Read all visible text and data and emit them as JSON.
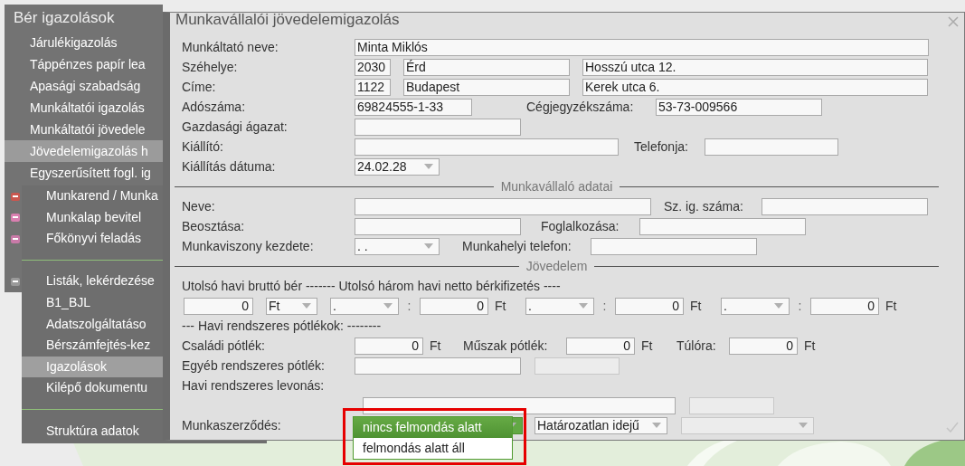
{
  "menu": {
    "title": "Bér igazolások",
    "items": [
      {
        "label": "Járulékigazolás",
        "selected": false
      },
      {
        "label": "Táppénzes papír lea",
        "selected": false
      },
      {
        "label": "Apasági szabadság",
        "selected": false
      },
      {
        "label": "Munkáltatói igazolás",
        "selected": false
      },
      {
        "label": "Munkáltatói jövedele",
        "selected": false
      },
      {
        "label": "Jövedelemigazolás h",
        "selected": true
      },
      {
        "label": "Egyszerűsített fogl. ig",
        "selected": false
      }
    ]
  },
  "submenu": {
    "items": [
      {
        "kind": "item",
        "label": "Munkarend / Munka",
        "selected": false,
        "icon": true
      },
      {
        "kind": "item",
        "label": "Munkalap bevitel",
        "selected": false,
        "icon": true
      },
      {
        "kind": "item",
        "label": "Főkönyvi feladás",
        "selected": false,
        "icon": true
      },
      {
        "kind": "divider"
      },
      {
        "kind": "item",
        "label": "Listák, lekérdezése",
        "selected": false,
        "icon": true
      },
      {
        "kind": "item",
        "label": "B1_BJL",
        "selected": false,
        "icon": false
      },
      {
        "kind": "item",
        "label": "Adatszolgáltatáso",
        "selected": false,
        "icon": false
      },
      {
        "kind": "item",
        "label": "Bérszámfejtés-kez",
        "selected": false,
        "icon": false
      },
      {
        "kind": "item",
        "label": "Igazolások",
        "selected": true,
        "icon": false
      },
      {
        "kind": "item",
        "label": "Kilépő dokumentu",
        "selected": false,
        "icon": false
      },
      {
        "kind": "divider"
      },
      {
        "kind": "item",
        "label": "Struktúra adatok",
        "selected": false,
        "icon": false
      }
    ]
  },
  "dialog": {
    "title": "Munkavállalói jövedelemigazolás",
    "employer": {
      "name": {
        "label": "Munkáltató neve:",
        "value": "Minta Miklós"
      },
      "seat": {
        "label": "Széhelye:",
        "zip": "2030",
        "city": "Érd",
        "street": "Hosszú utca 12."
      },
      "address": {
        "label": "Címe:",
        "zip": "1122",
        "city": "Budapest",
        "street": "Kerek utca 6."
      },
      "tax_number": {
        "label": "Adószáma:",
        "value": "69824555-1-33"
      },
      "registration_number": {
        "label": "Cégjegyzékszáma:",
        "value": "53-73-009566"
      },
      "sector": {
        "label": "Gazdasági ágazat:"
      },
      "issuer": {
        "label": "Kiállító:"
      },
      "phone": {
        "label": "Telefonja:"
      },
      "issue_date": {
        "label": "Kiállítás dátuma:",
        "value": "24.02.28"
      }
    },
    "employee_section": "Munkavállaló adatai",
    "employee": {
      "name": {
        "label": "Neve:"
      },
      "id_number": {
        "label": "Sz. ig. száma:"
      },
      "position": {
        "label": "Beosztása:"
      },
      "occupation": {
        "label": "Foglalkozása:"
      },
      "start_date": {
        "label": "Munkaviszony kezdete:",
        "value": ". ."
      },
      "work_phone": {
        "label": "Munkahelyi telefon:"
      }
    },
    "income_section": "Jövedelem",
    "income": {
      "heading": "Utolsó havi bruttó bér  ------- Utolsó három havi netto bérkifizetés ----",
      "gross": {
        "value": "0",
        "currency": "Ft"
      },
      "net": [
        {
          "month": ".",
          "separator": ":",
          "value": "0",
          "unit": "Ft"
        },
        {
          "month": ".",
          "separator": ":",
          "value": "0",
          "unit": "Ft"
        },
        {
          "month": ".",
          "separator": ":",
          "value": "0",
          "unit": "Ft"
        }
      ],
      "allowances_heading": "--- Havi rendszeres pótlékok: --------",
      "family": {
        "label": "Családi pótlék:",
        "value": "0",
        "unit": "Ft"
      },
      "shift": {
        "label": "Műszak pótlék:",
        "value": "0",
        "unit": "Ft"
      },
      "overtime": {
        "label": "Túlóra:",
        "value": "0",
        "unit": "Ft"
      },
      "other": {
        "label": "Egyéb rendszeres pótlék:",
        "fields": [
          {
            "disabled": false
          },
          {
            "disabled": true
          }
        ]
      },
      "deduction": {
        "label": "Havi rendszeres levonás:",
        "fields": [
          {
            "disabled": false
          },
          {
            "disabled": true
          }
        ]
      }
    },
    "contract": {
      "label": "Munkaszerződés:",
      "selects": [
        {
          "kind": "open",
          "options": [
            {
              "label": "nincs felmondás alatt",
              "selected": true
            },
            {
              "label": "felmondás alatt áll",
              "selected": false
            }
          ]
        },
        {
          "kind": "closed",
          "value": "Határozatlan idejű",
          "disabled": false
        },
        {
          "kind": "closed",
          "disabled": true
        }
      ]
    }
  }
}
